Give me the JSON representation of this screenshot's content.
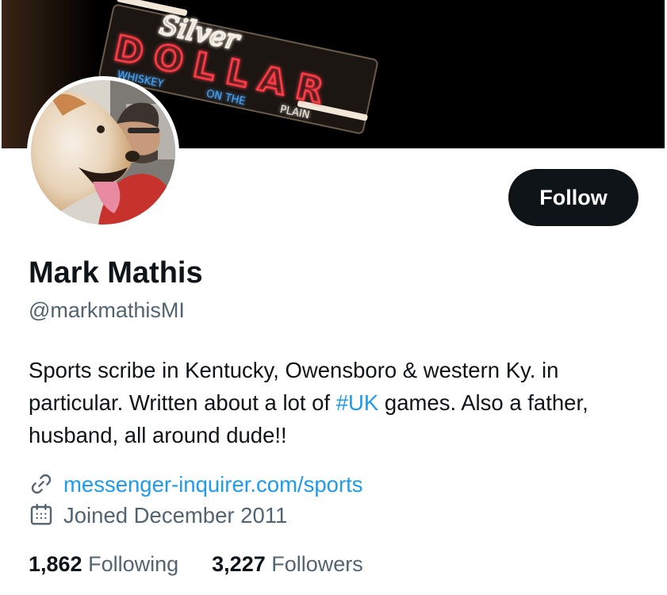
{
  "profile": {
    "name": "Mark Mathis",
    "handle": "@markmathisMI",
    "bio": {
      "before": "Sports scribe in Kentucky, Owensboro & western Ky. in particular. Written about a lot of ",
      "hashtag": "#UK",
      "after": " games. Also a father, husband, all around dude!!"
    },
    "website": "messenger-inquirer.com/sports",
    "joined": "Joined December 2011",
    "following_count": "1,862",
    "following_label": "Following",
    "followers_count": "3,227",
    "followers_label": "Followers"
  },
  "actions": {
    "follow_label": "Follow"
  },
  "banner": {
    "sign_script": "Silver",
    "sign_main": "DOLLAR",
    "sign_left": "WHISKEY",
    "sign_mid": "ON THE",
    "sign_right": "PLAIN"
  },
  "icons": {
    "link": "link-icon",
    "calendar": "calendar-icon"
  },
  "colors": {
    "text": "#0f1419",
    "secondary": "#536471",
    "link": "#1d9bf0",
    "button": "#0f1419"
  }
}
